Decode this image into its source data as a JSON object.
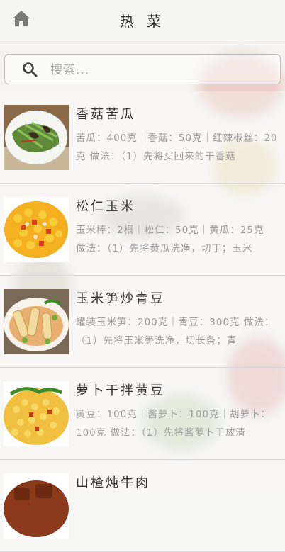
{
  "header": {
    "title": "热 菜",
    "home_icon": "home-icon"
  },
  "search": {
    "placeholder": "搜索...",
    "value": "",
    "icon": "search-icon"
  },
  "recipes": [
    {
      "name": "香菇苦瓜",
      "description": "苦瓜：400克｜香菇：50克｜红辣椒丝：20克  做法：（1）先将买回来的干香菇"
    },
    {
      "name": "松仁玉米",
      "description": "玉米棒：2根｜松仁：50克｜黄瓜：25克  做法：（1）先将黄瓜洗净，切丁；玉米"
    },
    {
      "name": "玉米笋炒青豆",
      "description": "罐装玉米笋：200克｜青豆：300克  做法：（1）先将玉米笋洗净，切长条；青"
    },
    {
      "name": "萝卜干拌黄豆",
      "description": "黄豆：100克｜酱萝卜：100克｜胡萝卜：100克  做法：（1）先将酱萝卜干放清"
    },
    {
      "name": "山楂炖牛肉",
      "description": ""
    }
  ]
}
